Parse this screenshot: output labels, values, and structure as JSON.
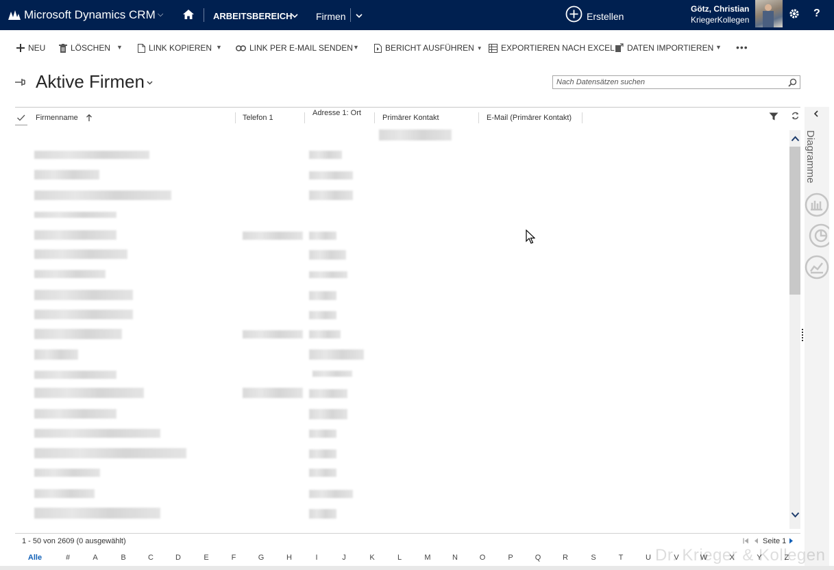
{
  "nav": {
    "app_title": "Microsoft Dynamics CRM",
    "workspace_label": "ARBEITSBEREICH",
    "entity_label": "Firmen",
    "create_label": "Erstellen",
    "user_name": "Götz, Christian",
    "org_name": "KriegerKollegen",
    "help_label": "?"
  },
  "commands": {
    "new_label": "NEU",
    "delete_label": "LÖSCHEN",
    "copy_link_label": "LINK KOPIEREN",
    "email_link_label": "LINK PER E-MAIL SENDEN",
    "run_report_label": "BERICHT AUSFÜHREN",
    "export_excel_label": "EXPORTIEREN NACH EXCEL",
    "import_data_label": "DATEN IMPORTIEREN",
    "more_label": "•••"
  },
  "view": {
    "title": "Aktive Firmen",
    "search_placeholder": "Nach Datensätzen suchen"
  },
  "grid": {
    "columns": [
      "Firmenname",
      "Telefon 1",
      "Adresse 1: Ort",
      "Primärer Kontakt",
      "E-Mail (Primärer Kontakt)"
    ],
    "sort_column": "Firmenname",
    "sort_direction": "ascending"
  },
  "side_pane": {
    "label": "Diagramme"
  },
  "footer": {
    "record_count": "1 - 50  von 2609 (0 ausgewählt)",
    "page_label": "Seite 1",
    "letters": [
      "Alle",
      "#",
      "A",
      "B",
      "C",
      "D",
      "E",
      "F",
      "G",
      "H",
      "I",
      "J",
      "K",
      "L",
      "M",
      "N",
      "O",
      "P",
      "Q",
      "R",
      "S",
      "T",
      "U",
      "V",
      "W",
      "X",
      "Y",
      "Z"
    ],
    "active_letter": "Alle"
  },
  "watermark": "Dr. Krieger & Kollegen",
  "colors": {
    "nav_background": "#002050",
    "link_blue": "#1160b7"
  }
}
